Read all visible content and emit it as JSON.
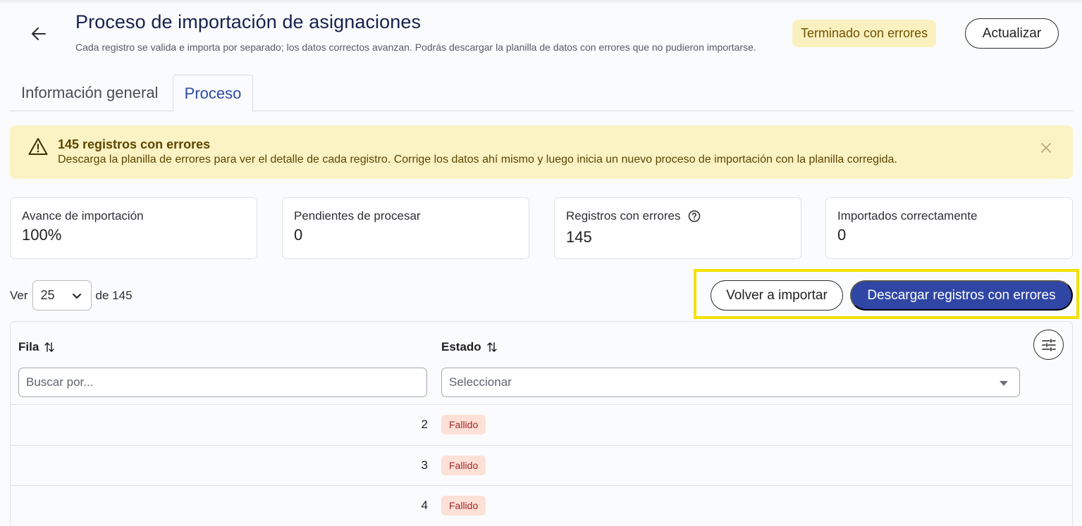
{
  "header": {
    "title": "Proceso de importación de asignaciones",
    "subtitle": "Cada registro se valida e importa por separado; los datos correctos avanzan. Podrás descargar la planilla de datos con errores que no pudieron importarse.",
    "status": "Terminado con errores",
    "refresh_label": "Actualizar",
    "back_icon": "arrow-left-icon"
  },
  "tabs": [
    {
      "label": "Información general",
      "active": false
    },
    {
      "label": "Proceso",
      "active": true
    }
  ],
  "alert": {
    "title": "145 registros con errores",
    "text": "Descarga la planilla de errores para ver el detalle de cada registro. Corrige los datos ahí mismo y luego inicia un nuevo proceso de importación con la planilla corregida.",
    "icon": "warning-icon",
    "close_icon": "close-icon"
  },
  "stats": [
    {
      "label": "Avance de importación",
      "value": "100%"
    },
    {
      "label": "Pendientes de procesar",
      "value": "0"
    },
    {
      "label": "Registros con errores",
      "value": "145",
      "help_icon": "question-circle-icon"
    },
    {
      "label": "Importados correctamente",
      "value": "0"
    }
  ],
  "pager": {
    "prefix": "Ver",
    "page_size": "25",
    "suffix": "de 145"
  },
  "actions": {
    "reimport_label": "Volver a importar",
    "download_label": "Descargar registros con errores"
  },
  "table": {
    "columns": [
      {
        "label": "Fila"
      },
      {
        "label": "Estado"
      }
    ],
    "search_placeholder": "Buscar por...",
    "status_placeholder": "Seleccionar",
    "rows": [
      {
        "fila": "2",
        "estado": "Fallido"
      },
      {
        "fila": "3",
        "estado": "Fallido"
      },
      {
        "fila": "4",
        "estado": "Fallido"
      }
    ]
  },
  "colors": {
    "primary": "#2f46a5",
    "status_bg": "#fbf0bf",
    "alert_bg": "#fcf3c4",
    "badge_bg": "#fde0d6",
    "badge_text": "#a3262a",
    "highlight": "#f4e000"
  }
}
